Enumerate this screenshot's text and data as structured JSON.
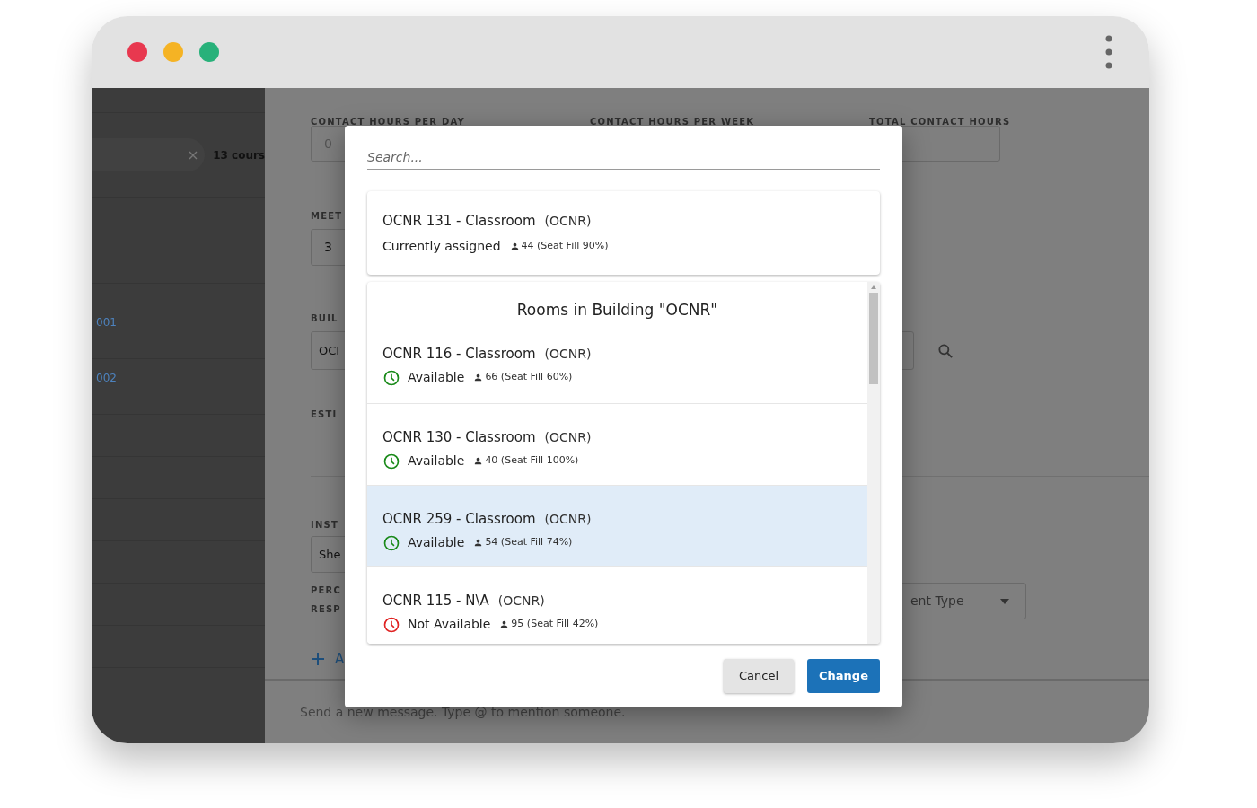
{
  "sidebar": {
    "course_count": "13 cours",
    "rows": [
      "001",
      "002"
    ]
  },
  "form": {
    "header_labels": [
      "CONTACT HOURS PER DAY",
      "CONTACT HOURS PER WEEK",
      "TOTAL CONTACT HOURS"
    ],
    "contact_value": "0",
    "meetings_label": "MEET",
    "meetings_value": "3",
    "building_label": "BUIL",
    "building_value": "OCI",
    "estimate_label": "ESTI",
    "estimate_value": "-",
    "instructor_label": "INST",
    "instructor_value": "She",
    "percent_labels": [
      "PERC",
      "RESP"
    ],
    "assignment_type": "ent Type",
    "add_label": "A"
  },
  "message_placeholder": "Send a new message. Type @ to mention someone.",
  "dialog": {
    "search": {
      "placeholder": "Search..."
    },
    "current_room": {
      "name": "OCNR 131 - Classroom",
      "building": "(OCNR)",
      "status": "Currently assigned",
      "capacity": "44 (Seat Fill 90%)"
    },
    "section_title": "Rooms in Building \"OCNR\"",
    "rooms": [
      {
        "name": "OCNR 116 - Classroom",
        "building": "(OCNR)",
        "available": true,
        "status": "Available",
        "capacity": "66 (Seat Fill 60%)",
        "selected": false
      },
      {
        "name": "OCNR 130 - Classroom",
        "building": "(OCNR)",
        "available": true,
        "status": "Available",
        "capacity": "40 (Seat Fill 100%)",
        "selected": false
      },
      {
        "name": "OCNR 259 - Classroom",
        "building": "(OCNR)",
        "available": true,
        "status": "Available",
        "capacity": "54 (Seat Fill 74%)",
        "selected": true
      },
      {
        "name": "OCNR 115 - N\\A",
        "building": "(OCNR)",
        "available": false,
        "status": "Not Available",
        "capacity": "95 (Seat Fill 42%)",
        "selected": false
      }
    ],
    "buttons": {
      "cancel": "Cancel",
      "change": "Change"
    }
  }
}
